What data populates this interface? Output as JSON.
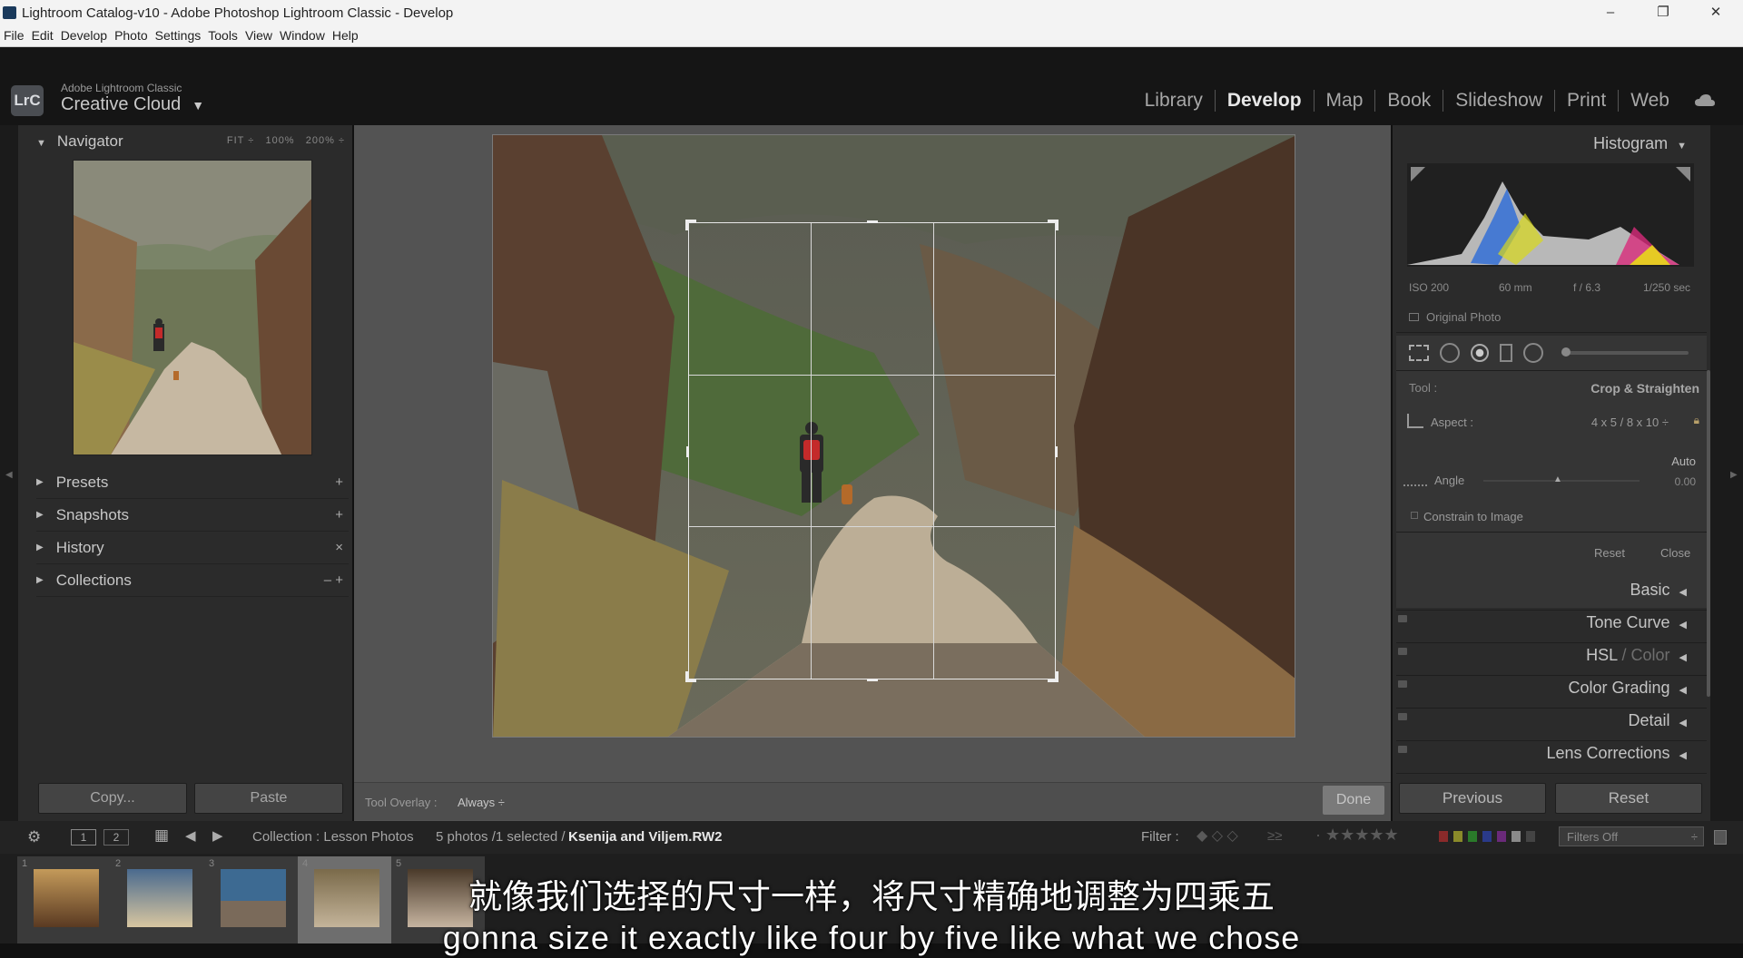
{
  "window": {
    "title": "Lightroom Catalog-v10 - Adobe Photoshop Lightroom Classic - Develop",
    "controls": [
      "–",
      "❐",
      "✕"
    ]
  },
  "menu": [
    "File",
    "Edit",
    "Develop",
    "Photo",
    "Settings",
    "Tools",
    "View",
    "Window",
    "Help"
  ],
  "brand": {
    "logo": "LrC",
    "line1": "Adobe Lightroom Classic",
    "line2": "Creative Cloud"
  },
  "modules": [
    {
      "label": "Library"
    },
    {
      "label": "Develop",
      "active": true
    },
    {
      "label": "Map"
    },
    {
      "label": "Book"
    },
    {
      "label": "Slideshow"
    },
    {
      "label": "Print"
    },
    {
      "label": "Web"
    }
  ],
  "navigator": {
    "title": "Navigator",
    "fit": "FIT",
    "zoom100": "100%",
    "zoom200": "200%"
  },
  "left_sections": [
    {
      "label": "Presets",
      "action": "+"
    },
    {
      "label": "Snapshots",
      "action": "+"
    },
    {
      "label": "History",
      "action": "×"
    },
    {
      "label": "Collections",
      "action": "– +"
    }
  ],
  "left_buttons": {
    "copy": "Copy...",
    "paste": "Paste"
  },
  "toolbar": {
    "overlay_label": "Tool Overlay :",
    "overlay_value": "Always",
    "done": "Done"
  },
  "histogram": {
    "title": "Histogram",
    "iso": "ISO 200",
    "focal": "60 mm",
    "aperture": "f / 6.3",
    "shutter": "1/250 sec",
    "original_photo": "Original Photo"
  },
  "crop_panel": {
    "tool_label": "Tool :",
    "tool_value": "Crop & Straighten",
    "aspect_label": "Aspect :",
    "aspect_value": "4 x 5  /  8 x 10",
    "auto": "Auto",
    "angle_label": "Angle",
    "angle_value": "0.00",
    "constrain": "Constrain to Image",
    "reset": "Reset",
    "close": "Close"
  },
  "right_sections": [
    {
      "label": "Basic"
    },
    {
      "label": "Tone Curve"
    },
    {
      "label": "HSL",
      "dim": " / Color"
    },
    {
      "label": "Color Grading"
    },
    {
      "label": "Detail"
    },
    {
      "label": "Lens Corrections"
    }
  ],
  "right_buttons": {
    "previous": "Previous",
    "reset": "Reset"
  },
  "filmbar": {
    "collection": "Collection : Lesson Photos",
    "count": "5 photos /1 selected /",
    "filename": "Ksenija and Viljem.RW2",
    "filter_label": "Filter :",
    "filters_off": "Filters Off",
    "view1": "1",
    "view2": "2"
  },
  "thumbnails": [
    {
      "n": "1",
      "colors": [
        "#5a3a22",
        "#c49a5a"
      ]
    },
    {
      "n": "2",
      "colors": [
        "#4a6a8e",
        "#d8c6a0"
      ]
    },
    {
      "n": "3",
      "colors": [
        "#3d6a92",
        "#7a6a5a"
      ]
    },
    {
      "n": "4",
      "colors": [
        "#7a6a4a",
        "#c4b49a"
      ],
      "selected": true
    },
    {
      "n": "5",
      "colors": [
        "#4a3a2a",
        "#c6b4a0"
      ]
    }
  ],
  "subtitles": {
    "cn": "就像我们选择的尺寸一样，将尺寸精确地调整为四乘五",
    "en": "gonna size it exactly like four by five like what we chose"
  },
  "colors": {
    "panel": "#2b2b2b",
    "centre": "#535353",
    "accent_text": "#e8e8e8"
  }
}
